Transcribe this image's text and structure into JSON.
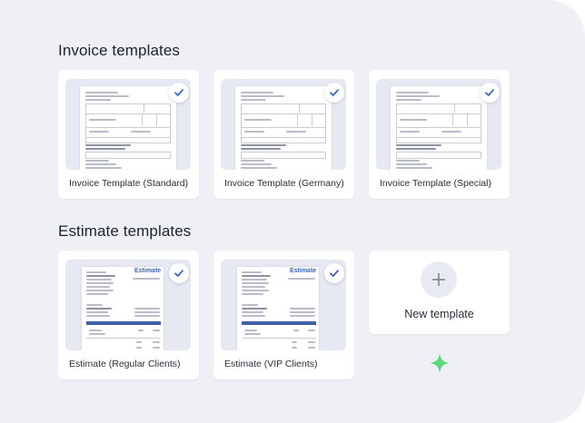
{
  "sections": {
    "invoice": {
      "title": "Invoice templates",
      "cards": [
        {
          "label": "Invoice Template (Standard)",
          "selected": true
        },
        {
          "label": "Invoice Template (Germany)",
          "selected": true
        },
        {
          "label": "Invoice Template (Special)",
          "selected": true
        }
      ]
    },
    "estimate": {
      "title": "Estimate templates",
      "preview_heading": "Estimate",
      "cards": [
        {
          "label": "Estimate (Regular Clients)",
          "selected": true
        },
        {
          "label": "Estimate (VIP Clients)",
          "selected": true
        }
      ],
      "new_card": {
        "label": "New template",
        "icon": "plus-icon"
      }
    }
  },
  "icons": {
    "check": "check-icon",
    "sparkle": "sparkle-icon"
  },
  "colors": {
    "background": "#eff0f6",
    "accent": "#3a64c8",
    "sparkle": "#5ed67a",
    "estimate_bar": "#3d5fa8"
  }
}
